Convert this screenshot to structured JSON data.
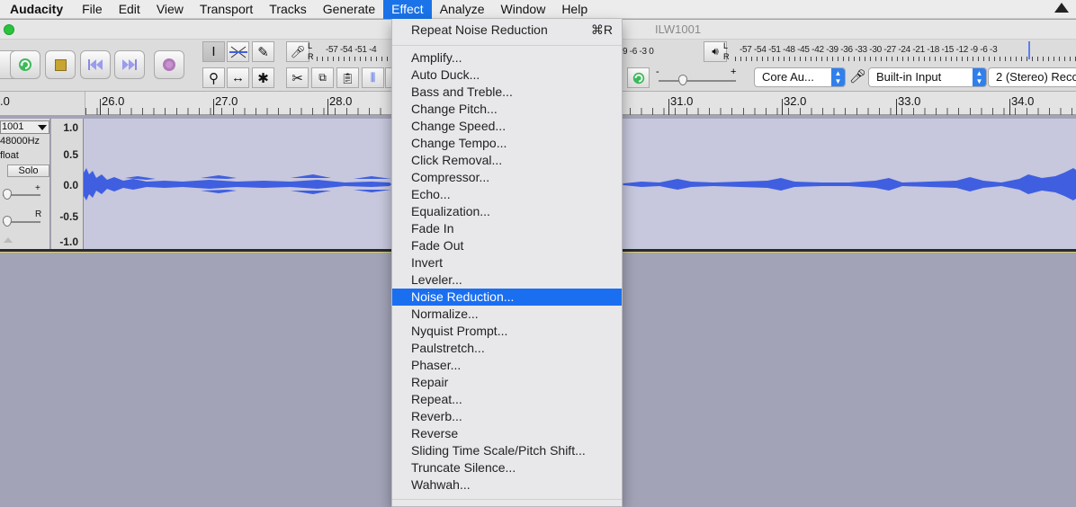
{
  "menubar": {
    "app": "Audacity",
    "items": [
      "File",
      "Edit",
      "View",
      "Transport",
      "Tracks",
      "Generate",
      "Effect",
      "Analyze",
      "Window",
      "Help"
    ],
    "active": "Effect"
  },
  "window": {
    "title": "ILW1001"
  },
  "toolbar": {
    "record_meter_labels": "-57 -54 -51 -4",
    "playback_meter_left": "9  -6  -3  0",
    "playback_meter_labels": "-57 -54 -51 -48 -45 -42 -39 -36 -33 -30 -27 -24 -21 -18 -15 -12  -9  -6  -3",
    "record_meter_lr": [
      "L",
      "R"
    ],
    "playback_meter_lr": [
      "L",
      "R"
    ],
    "host_combo": "Core Au...",
    "input_device_combo": "Built-in Input",
    "channels_combo": "2 (Stereo) Reco",
    "speed_min": "-",
    "speed_max": "+"
  },
  "ruler": {
    "left_label": ".0",
    "ticks": [
      "26.0",
      "27.0",
      "28.0",
      "31.0",
      "32.0",
      "33.0",
      "34.0"
    ]
  },
  "track": {
    "name": "1001",
    "rate": "48000Hz",
    "format": "float",
    "solo_label": "Solo",
    "gain_label": "+",
    "pan_label": "R",
    "scale": [
      "1.0",
      "0.5",
      "0.0",
      "-0.5",
      "-1.0"
    ]
  },
  "effect_menu": {
    "repeat": {
      "label": "Repeat Noise Reduction",
      "shortcut": "⌘R"
    },
    "items": [
      "Amplify...",
      "Auto Duck...",
      "Bass and Treble...",
      "Change Pitch...",
      "Change Speed...",
      "Change Tempo...",
      "Click Removal...",
      "Compressor...",
      "Echo...",
      "Equalization...",
      "Fade In",
      "Fade Out",
      "Invert",
      "Leveler...",
      "Noise Reduction...",
      "Normalize...",
      "Nyquist Prompt...",
      "Paulstretch...",
      "Phaser...",
      "Repair",
      "Repeat...",
      "Reverb...",
      "Reverse",
      "Sliding Time Scale/Pitch Shift...",
      "Truncate Silence...",
      "Wahwah..."
    ],
    "highlighted": "Noise Reduction..."
  },
  "colors": {
    "menu_highlight": "#1a6ff0",
    "waveform": "#3f5fe0",
    "track_bg": "#c7c7dd",
    "empty_area": "#a3a3b8"
  }
}
